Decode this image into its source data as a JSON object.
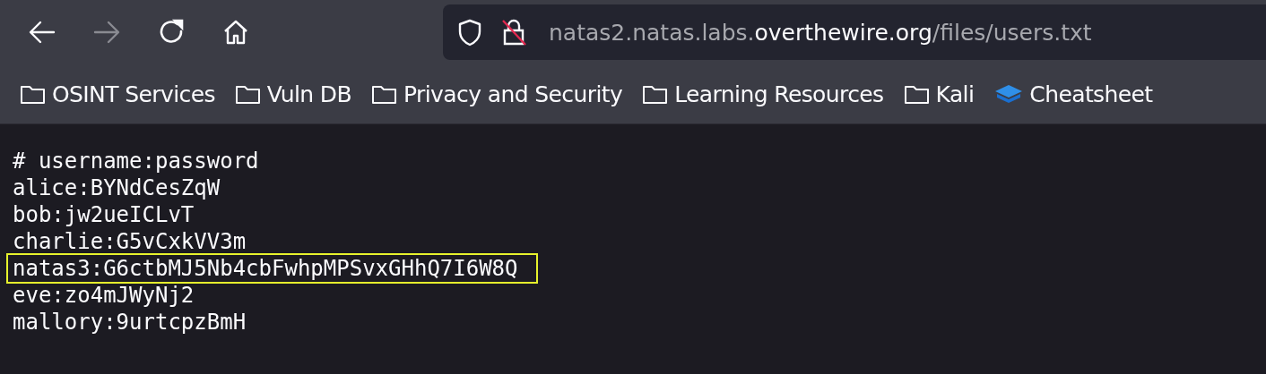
{
  "toolbar": {
    "back": {
      "disabled": false
    },
    "forward": {
      "disabled": true
    },
    "address_bar": {
      "insecure": true,
      "url_parts": [
        {
          "text": "natas2.natas.labs.",
          "emphasis": false
        },
        {
          "text": "overthewire.org",
          "emphasis": true
        },
        {
          "text": "/files/users.txt",
          "emphasis": false
        }
      ]
    }
  },
  "bookmarks": [
    {
      "label": "OSINT Services",
      "kind": "folder"
    },
    {
      "label": "Vuln DB",
      "kind": "folder"
    },
    {
      "label": "Privacy and Security",
      "kind": "folder"
    },
    {
      "label": "Learning Resources",
      "kind": "folder"
    },
    {
      "label": "Kali",
      "kind": "folder"
    },
    {
      "label": "Cheatsheet",
      "kind": "bookmark"
    }
  ],
  "document": {
    "lines": [
      {
        "text": "# username:password",
        "highlighted": false
      },
      {
        "text": "alice:BYNdCesZqW",
        "highlighted": false
      },
      {
        "text": "bob:jw2ueICLvT",
        "highlighted": false
      },
      {
        "text": "charlie:G5vCxkVV3m",
        "highlighted": false
      },
      {
        "text": "natas3:G6ctbMJ5Nb4cbFwhpMPSvxGHhQ7I6W8Q",
        "highlighted": true
      },
      {
        "text": "eve:zo4mJWyNj2",
        "highlighted": false
      },
      {
        "text": "mallory:9urtcpzBmH",
        "highlighted": false
      }
    ]
  }
}
